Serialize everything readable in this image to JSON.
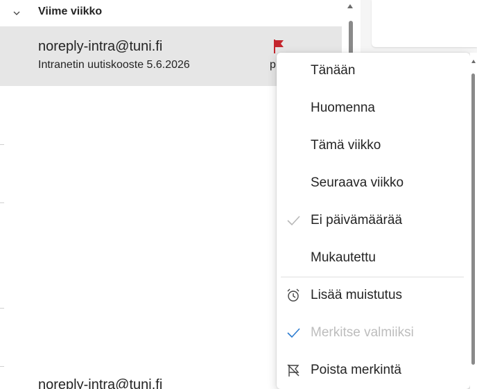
{
  "mail_list": {
    "group_label": "Viime viikko",
    "messages": [
      {
        "sender": "noreply-intra@tuni.fi",
        "subject": "Intranetin uutiskooste 5.6.2026",
        "date_fragment": "p",
        "flagged": true
      },
      {
        "sender": "noreply-intra@tuni.fi"
      }
    ]
  },
  "flag_menu": {
    "items": [
      {
        "label": "Tänään",
        "icon": null,
        "disabled": false
      },
      {
        "label": "Huomenna",
        "icon": null,
        "disabled": false
      },
      {
        "label": "Tämä viikko",
        "icon": null,
        "disabled": false
      },
      {
        "label": "Seuraava viikko",
        "icon": null,
        "disabled": false
      },
      {
        "label": "Ei päivämäärää",
        "icon": "checkmark-icon",
        "disabled": false
      },
      {
        "label": "Mukautettu",
        "icon": null,
        "disabled": false
      },
      {
        "label": "Lisää muistutus",
        "icon": "alarm-clock-icon",
        "disabled": false
      },
      {
        "label": "Merkitse valmiiksi",
        "icon": "checkmark-icon",
        "disabled": true
      },
      {
        "label": "Poista merkintä",
        "icon": "flag-off-icon",
        "disabled": false
      }
    ]
  },
  "colors": {
    "flag": "#c4262e",
    "check_accent": "#2b7bd0",
    "check_muted": "#b8b8b8",
    "selected_row": "#e6e6e6"
  }
}
